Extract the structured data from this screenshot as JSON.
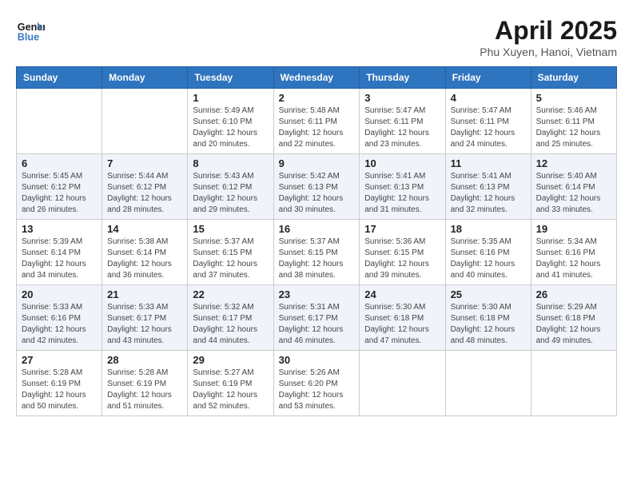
{
  "header": {
    "logo_line1": "General",
    "logo_line2": "Blue",
    "month_year": "April 2025",
    "location": "Phu Xuyen, Hanoi, Vietnam"
  },
  "weekdays": [
    "Sunday",
    "Monday",
    "Tuesday",
    "Wednesday",
    "Thursday",
    "Friday",
    "Saturday"
  ],
  "weeks": [
    [
      {
        "day": "",
        "info": ""
      },
      {
        "day": "",
        "info": ""
      },
      {
        "day": "1",
        "info": "Sunrise: 5:49 AM\nSunset: 6:10 PM\nDaylight: 12 hours and 20 minutes."
      },
      {
        "day": "2",
        "info": "Sunrise: 5:48 AM\nSunset: 6:11 PM\nDaylight: 12 hours and 22 minutes."
      },
      {
        "day": "3",
        "info": "Sunrise: 5:47 AM\nSunset: 6:11 PM\nDaylight: 12 hours and 23 minutes."
      },
      {
        "day": "4",
        "info": "Sunrise: 5:47 AM\nSunset: 6:11 PM\nDaylight: 12 hours and 24 minutes."
      },
      {
        "day": "5",
        "info": "Sunrise: 5:46 AM\nSunset: 6:11 PM\nDaylight: 12 hours and 25 minutes."
      }
    ],
    [
      {
        "day": "6",
        "info": "Sunrise: 5:45 AM\nSunset: 6:12 PM\nDaylight: 12 hours and 26 minutes."
      },
      {
        "day": "7",
        "info": "Sunrise: 5:44 AM\nSunset: 6:12 PM\nDaylight: 12 hours and 28 minutes."
      },
      {
        "day": "8",
        "info": "Sunrise: 5:43 AM\nSunset: 6:12 PM\nDaylight: 12 hours and 29 minutes."
      },
      {
        "day": "9",
        "info": "Sunrise: 5:42 AM\nSunset: 6:13 PM\nDaylight: 12 hours and 30 minutes."
      },
      {
        "day": "10",
        "info": "Sunrise: 5:41 AM\nSunset: 6:13 PM\nDaylight: 12 hours and 31 minutes."
      },
      {
        "day": "11",
        "info": "Sunrise: 5:41 AM\nSunset: 6:13 PM\nDaylight: 12 hours and 32 minutes."
      },
      {
        "day": "12",
        "info": "Sunrise: 5:40 AM\nSunset: 6:14 PM\nDaylight: 12 hours and 33 minutes."
      }
    ],
    [
      {
        "day": "13",
        "info": "Sunrise: 5:39 AM\nSunset: 6:14 PM\nDaylight: 12 hours and 34 minutes."
      },
      {
        "day": "14",
        "info": "Sunrise: 5:38 AM\nSunset: 6:14 PM\nDaylight: 12 hours and 36 minutes."
      },
      {
        "day": "15",
        "info": "Sunrise: 5:37 AM\nSunset: 6:15 PM\nDaylight: 12 hours and 37 minutes."
      },
      {
        "day": "16",
        "info": "Sunrise: 5:37 AM\nSunset: 6:15 PM\nDaylight: 12 hours and 38 minutes."
      },
      {
        "day": "17",
        "info": "Sunrise: 5:36 AM\nSunset: 6:15 PM\nDaylight: 12 hours and 39 minutes."
      },
      {
        "day": "18",
        "info": "Sunrise: 5:35 AM\nSunset: 6:16 PM\nDaylight: 12 hours and 40 minutes."
      },
      {
        "day": "19",
        "info": "Sunrise: 5:34 AM\nSunset: 6:16 PM\nDaylight: 12 hours and 41 minutes."
      }
    ],
    [
      {
        "day": "20",
        "info": "Sunrise: 5:33 AM\nSunset: 6:16 PM\nDaylight: 12 hours and 42 minutes."
      },
      {
        "day": "21",
        "info": "Sunrise: 5:33 AM\nSunset: 6:17 PM\nDaylight: 12 hours and 43 minutes."
      },
      {
        "day": "22",
        "info": "Sunrise: 5:32 AM\nSunset: 6:17 PM\nDaylight: 12 hours and 44 minutes."
      },
      {
        "day": "23",
        "info": "Sunrise: 5:31 AM\nSunset: 6:17 PM\nDaylight: 12 hours and 46 minutes."
      },
      {
        "day": "24",
        "info": "Sunrise: 5:30 AM\nSunset: 6:18 PM\nDaylight: 12 hours and 47 minutes."
      },
      {
        "day": "25",
        "info": "Sunrise: 5:30 AM\nSunset: 6:18 PM\nDaylight: 12 hours and 48 minutes."
      },
      {
        "day": "26",
        "info": "Sunrise: 5:29 AM\nSunset: 6:18 PM\nDaylight: 12 hours and 49 minutes."
      }
    ],
    [
      {
        "day": "27",
        "info": "Sunrise: 5:28 AM\nSunset: 6:19 PM\nDaylight: 12 hours and 50 minutes."
      },
      {
        "day": "28",
        "info": "Sunrise: 5:28 AM\nSunset: 6:19 PM\nDaylight: 12 hours and 51 minutes."
      },
      {
        "day": "29",
        "info": "Sunrise: 5:27 AM\nSunset: 6:19 PM\nDaylight: 12 hours and 52 minutes."
      },
      {
        "day": "30",
        "info": "Sunrise: 5:26 AM\nSunset: 6:20 PM\nDaylight: 12 hours and 53 minutes."
      },
      {
        "day": "",
        "info": ""
      },
      {
        "day": "",
        "info": ""
      },
      {
        "day": "",
        "info": ""
      }
    ]
  ]
}
